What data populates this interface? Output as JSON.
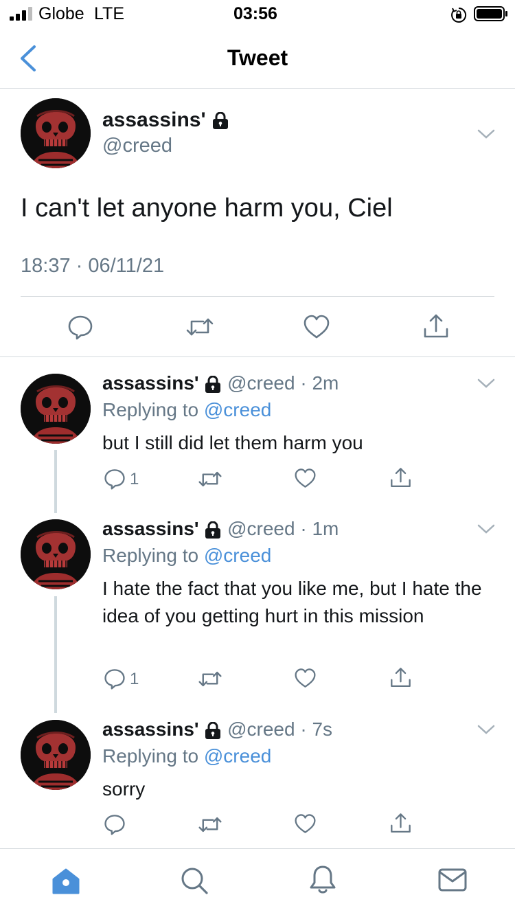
{
  "status_bar": {
    "carrier": "Globe",
    "network": "LTE",
    "time": "03:56"
  },
  "nav": {
    "title": "Tweet"
  },
  "main_tweet": {
    "display_name": "assassins'",
    "handle": "@creed",
    "text": "I can't let anyone harm you, Ciel",
    "timestamp": "18:37 · 06/11/21"
  },
  "replies": [
    {
      "display_name": "assassins'",
      "handle": "@creed",
      "age": "· 2m",
      "replying_label": "Replying to",
      "replying_to": "@creed",
      "text": "but I still did let them harm you",
      "reply_count": "1"
    },
    {
      "display_name": "assassins'",
      "handle": "@creed",
      "age": "· 1m",
      "replying_label": "Replying to",
      "replying_to": "@creed",
      "text": "I hate the fact that you like me, but I hate the idea of you getting hurt in this mission",
      "reply_count": "1"
    },
    {
      "display_name": "assassins'",
      "handle": "@creed",
      "age": "· 7s",
      "replying_label": "Replying to",
      "replying_to": "@creed",
      "text": "sorry",
      "reply_count": ""
    }
  ],
  "icons": {
    "reply": "reply-icon",
    "retweet": "retweet-icon",
    "like": "heart-icon",
    "share": "share-icon",
    "protected": "lock-icon",
    "more": "chevron-down-icon"
  },
  "tabs": [
    {
      "name": "home-icon",
      "active": true
    },
    {
      "name": "search-icon",
      "active": false
    },
    {
      "name": "notifications-icon",
      "active": false
    },
    {
      "name": "messages-icon",
      "active": false
    }
  ],
  "colors": {
    "accent": "#4a90d9",
    "secondary_text": "#657786",
    "divider": "#d4d9dd"
  }
}
